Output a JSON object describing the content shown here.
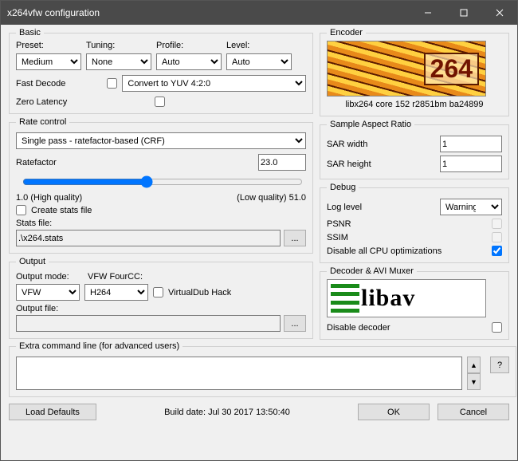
{
  "window": {
    "title": "x264vfw configuration"
  },
  "basic": {
    "legend": "Basic",
    "preset_label": "Preset:",
    "preset_value": "Medium",
    "tuning_label": "Tuning:",
    "tuning_value": "None",
    "profile_label": "Profile:",
    "profile_value": "Auto",
    "level_label": "Level:",
    "level_value": "Auto",
    "fast_decode_label": "Fast Decode",
    "convert_label": "Convert to YUV 4:2:0",
    "zero_latency_label": "Zero Latency"
  },
  "encoder": {
    "legend": "Encoder",
    "badge": "264",
    "caption": "libx264 core 152 r2851bm ba24899"
  },
  "rate": {
    "legend": "Rate control",
    "mode_value": "Single pass - ratefactor-based (CRF)",
    "ratefactor_label": "Ratefactor",
    "ratefactor_value": "23.0",
    "low_marker": "1.0 (High quality)",
    "high_marker": "(Low quality) 51.0",
    "create_stats_label": "Create stats file",
    "stats_file_label": "Stats file:",
    "stats_file_value": ".\\x264.stats",
    "browse_label": "..."
  },
  "sar": {
    "legend": "Sample Aspect Ratio",
    "width_label": "SAR width",
    "width_value": "1",
    "height_label": "SAR height",
    "height_value": "1"
  },
  "debug": {
    "legend": "Debug",
    "loglevel_label": "Log level",
    "loglevel_value": "Warning",
    "psnr_label": "PSNR",
    "ssim_label": "SSIM",
    "disable_cpu_label": "Disable all CPU optimizations"
  },
  "output": {
    "legend": "Output",
    "mode_label": "Output mode:",
    "mode_value": "VFW",
    "fourcc_label": "VFW FourCC:",
    "fourcc_value": "H264",
    "vdub_label": "VirtualDub Hack",
    "file_label": "Output file:",
    "file_value": "",
    "browse_label": "..."
  },
  "decoder": {
    "legend": "Decoder & AVI Muxer",
    "logo_text": "libav",
    "disable_decoder_label": "Disable decoder"
  },
  "extra": {
    "legend": "Extra command line (for advanced users)",
    "value": "",
    "help_label": "?"
  },
  "footer": {
    "load_defaults": "Load Defaults",
    "build_date": "Build date: Jul 30 2017 13:50:40",
    "ok": "OK",
    "cancel": "Cancel"
  }
}
